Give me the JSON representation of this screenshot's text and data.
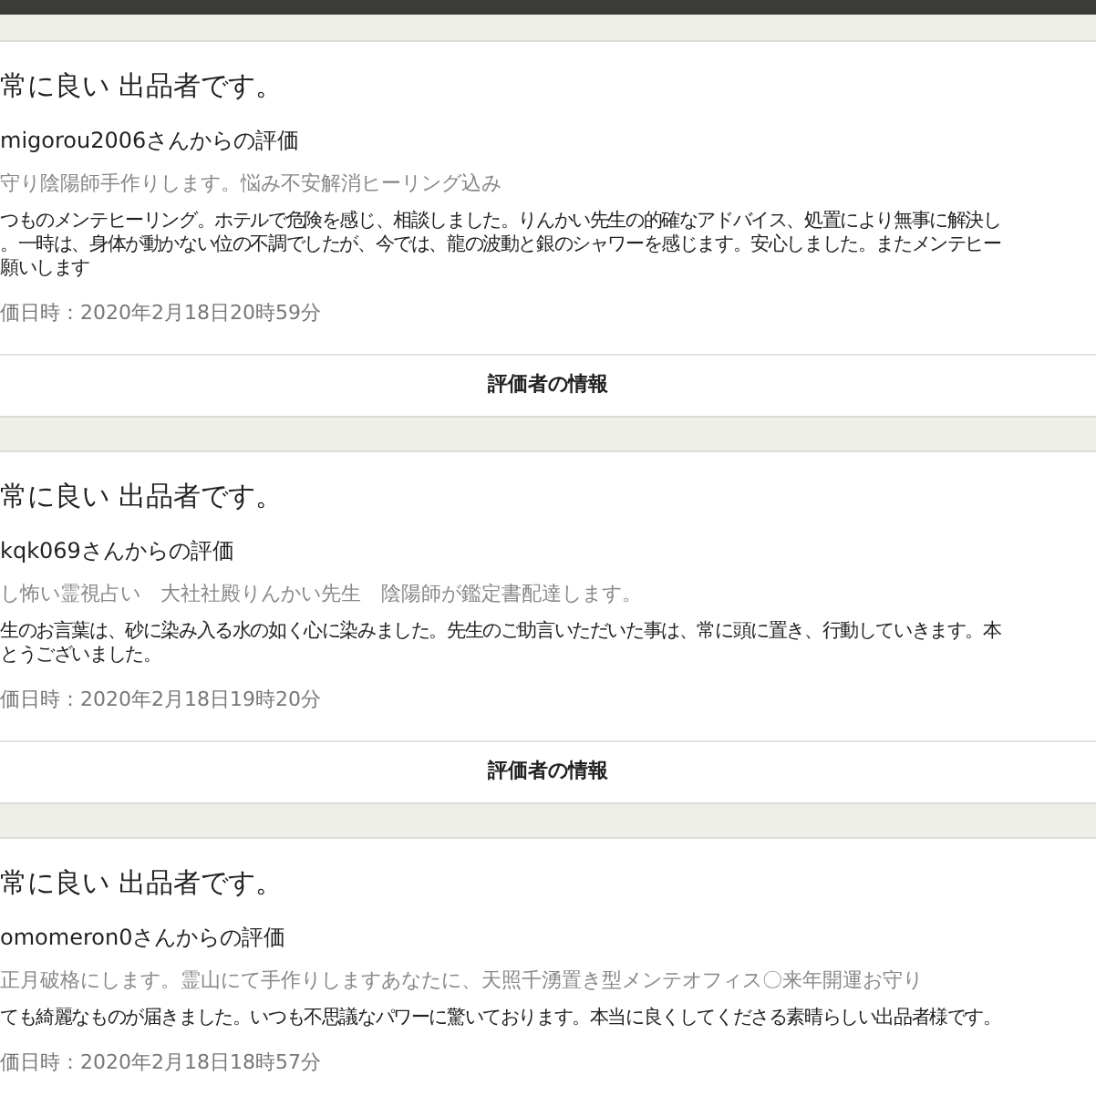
{
  "reviews": [
    {
      "rating": "常に良い 出品者です。",
      "reviewer": "migorou2006さんからの評価",
      "item": "守り陰陽師手作りします。悩み不安解消ヒーリング込み",
      "comment_lines": [
        "つものメンテヒーリング。ホテルで危険を感じ、相談しました。りんかい先生の的確なアドバイス、処置により無事に解決し",
        "。一時は、身体が動かない位の不調でしたが、今では、龍の波動と銀のシャワーを感じます。安心しました。またメンテヒー",
        "願いします"
      ],
      "date": "価日時：2020年2月18日20時59分",
      "button": "評価者の情報"
    },
    {
      "rating": "常に良い 出品者です。",
      "reviewer": "kqk069さんからの評価",
      "item": "し怖い霊視占い　大社社殿りんかい先生　陰陽師が鑑定書配達します。",
      "comment_lines": [
        "生のお言葉は、砂に染み入る水の如く心に染みました。先生のご助言いただいた事は、常に頭に置き、行動していきます。本",
        "とうございました。"
      ],
      "date": "価日時：2020年2月18日19時20分",
      "button": "評価者の情報"
    },
    {
      "rating": "常に良い 出品者です。",
      "reviewer": "omomeron0さんからの評価",
      "item": "正月破格にします。霊山にて手作りしますあなたに、天照千湧置き型メンテオフィス〇来年開運お守り",
      "comment_lines": [
        "ても綺麗なものが届きました。いつも不思議なパワーに驚いております。本当に良くしてくださる素晴らしい出品者様です。"
      ],
      "date": "価日時：2020年2月18日18時57分"
    }
  ]
}
